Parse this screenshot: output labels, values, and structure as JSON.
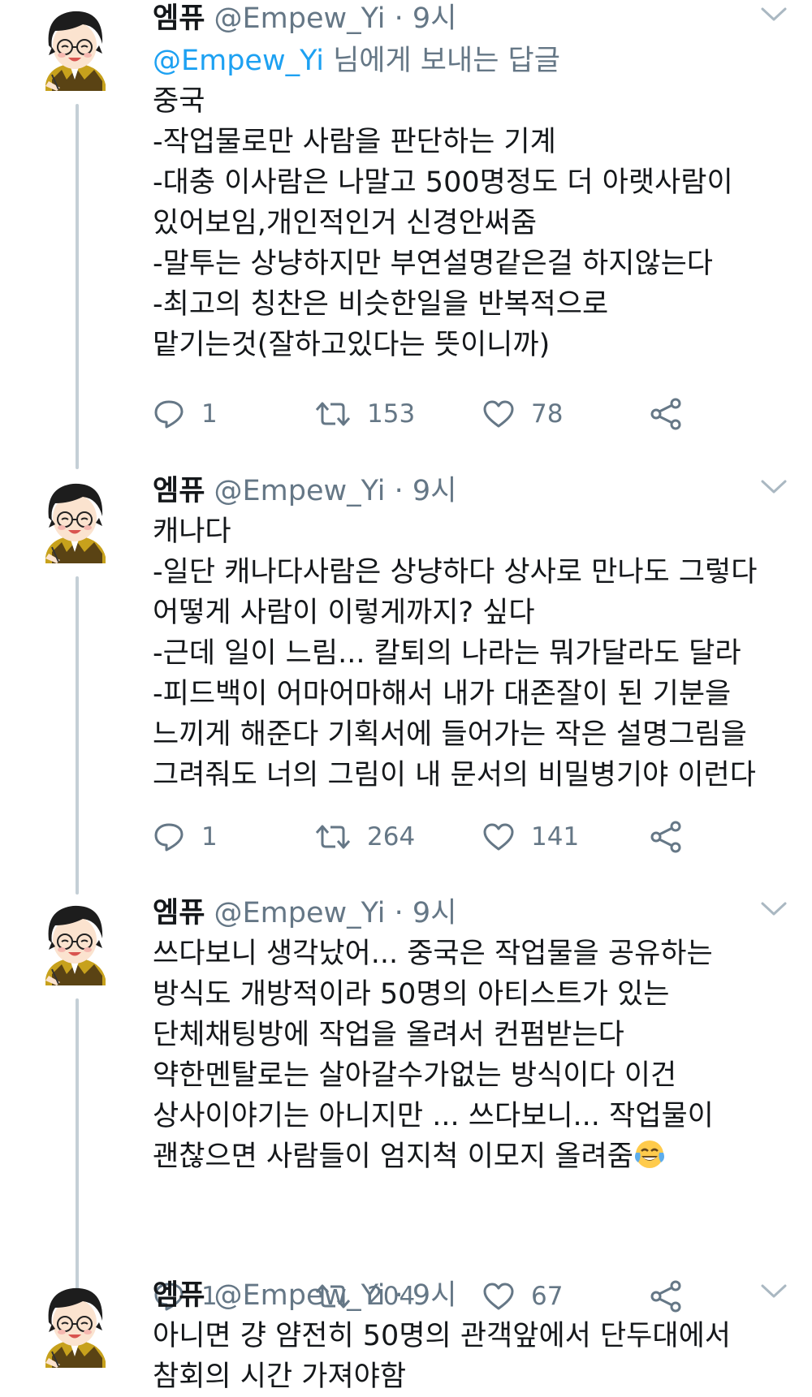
{
  "colors": {
    "link": "#1da1f2",
    "muted": "#657786",
    "text": "#14171a",
    "thread_line": "#c4cfd6"
  },
  "tweets": [
    {
      "name": "엠퓨",
      "handle": "@Empew_Yi",
      "separator": "·",
      "time": "9시",
      "reply_link": "@Empew_Yi",
      "reply_suffix": " 님에게 보내는 답글",
      "text": "중국\n-작업물로만 사람을 판단하는 기계\n-대충 이사람은 나말고 500명정도 더 아랫사람이\n있어보임,개인적인거 신경안써줌\n-말투는 상냥하지만 부연설명같은걸 하지않는다\n-최고의 칭찬은 비슷한일을 반복적으로\n맡기는것(잘하고있다는 뜻이니까)",
      "replies": "1",
      "retweets": "153",
      "likes": "78"
    },
    {
      "name": "엠퓨",
      "handle": "@Empew_Yi",
      "separator": "·",
      "time": "9시",
      "text": "캐나다\n-일단 캐나다사람은 상냥하다 상사로 만나도 그렇다\n어떻게 사람이 이렇게까지? 싶다\n-근데 일이 느림... 칼퇴의 나라는 뭐가달라도 달라\n-피드백이 어마어마해서 내가 대존잘이 된 기분을\n느끼게 해준다 기획서에 들어가는 작은 설명그림을\n그려줘도 너의 그림이 내 문서의 비밀병기야 이런다",
      "replies": "1",
      "retweets": "264",
      "likes": "141"
    },
    {
      "name": "엠퓨",
      "handle": "@Empew_Yi",
      "separator": "·",
      "time": "9시",
      "text": "쓰다보니 생각났어... 중국은 작업물을 공유하는\n방식도 개방적이라 50명의 아티스트가 있는\n단체채팅방에 작업을 올려서 컨펌받는다\n약한멘탈로는 살아갈수가없는 방식이다 이건\n상사이야기는 아니지만 ... 쓰다보니... 작업물이\n괜찮으면 사람들이 엄지척 이모지 올려줌",
      "emoji": "face-with-tears-of-joy",
      "replies": "1",
      "retweets": "204",
      "likes": "67"
    },
    {
      "name": "엠퓨",
      "handle": "@Empew_Yi",
      "separator": "·",
      "time": "9시",
      "text": "아니면 걍 얌전히 50명의 관객앞에서 단두대에서\n참회의 시간 가져야함"
    }
  ]
}
